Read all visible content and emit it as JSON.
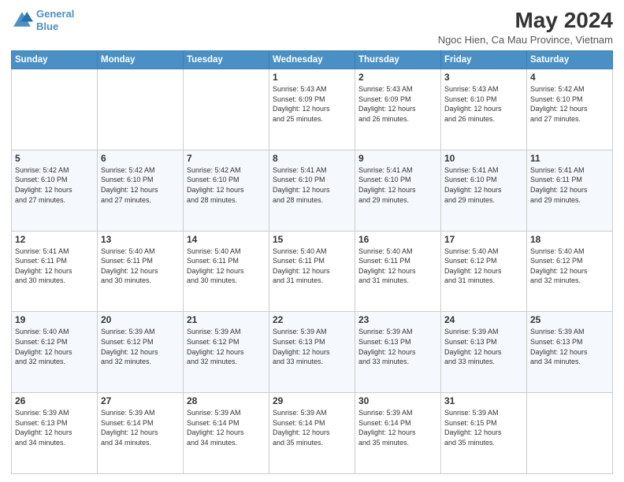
{
  "header": {
    "logo_line1": "General",
    "logo_line2": "Blue",
    "month_title": "May 2024",
    "subtitle": "Ngoc Hien, Ca Mau Province, Vietnam"
  },
  "weekdays": [
    "Sunday",
    "Monday",
    "Tuesday",
    "Wednesday",
    "Thursday",
    "Friday",
    "Saturday"
  ],
  "weeks": [
    [
      {
        "day": "",
        "info": ""
      },
      {
        "day": "",
        "info": ""
      },
      {
        "day": "",
        "info": ""
      },
      {
        "day": "1",
        "info": "Sunrise: 5:43 AM\nSunset: 6:09 PM\nDaylight: 12 hours\nand 25 minutes."
      },
      {
        "day": "2",
        "info": "Sunrise: 5:43 AM\nSunset: 6:09 PM\nDaylight: 12 hours\nand 26 minutes."
      },
      {
        "day": "3",
        "info": "Sunrise: 5:43 AM\nSunset: 6:10 PM\nDaylight: 12 hours\nand 26 minutes."
      },
      {
        "day": "4",
        "info": "Sunrise: 5:42 AM\nSunset: 6:10 PM\nDaylight: 12 hours\nand 27 minutes."
      }
    ],
    [
      {
        "day": "5",
        "info": "Sunrise: 5:42 AM\nSunset: 6:10 PM\nDaylight: 12 hours\nand 27 minutes."
      },
      {
        "day": "6",
        "info": "Sunrise: 5:42 AM\nSunset: 6:10 PM\nDaylight: 12 hours\nand 27 minutes."
      },
      {
        "day": "7",
        "info": "Sunrise: 5:42 AM\nSunset: 6:10 PM\nDaylight: 12 hours\nand 28 minutes."
      },
      {
        "day": "8",
        "info": "Sunrise: 5:41 AM\nSunset: 6:10 PM\nDaylight: 12 hours\nand 28 minutes."
      },
      {
        "day": "9",
        "info": "Sunrise: 5:41 AM\nSunset: 6:10 PM\nDaylight: 12 hours\nand 29 minutes."
      },
      {
        "day": "10",
        "info": "Sunrise: 5:41 AM\nSunset: 6:10 PM\nDaylight: 12 hours\nand 29 minutes."
      },
      {
        "day": "11",
        "info": "Sunrise: 5:41 AM\nSunset: 6:11 PM\nDaylight: 12 hours\nand 29 minutes."
      }
    ],
    [
      {
        "day": "12",
        "info": "Sunrise: 5:41 AM\nSunset: 6:11 PM\nDaylight: 12 hours\nand 30 minutes."
      },
      {
        "day": "13",
        "info": "Sunrise: 5:40 AM\nSunset: 6:11 PM\nDaylight: 12 hours\nand 30 minutes."
      },
      {
        "day": "14",
        "info": "Sunrise: 5:40 AM\nSunset: 6:11 PM\nDaylight: 12 hours\nand 30 minutes."
      },
      {
        "day": "15",
        "info": "Sunrise: 5:40 AM\nSunset: 6:11 PM\nDaylight: 12 hours\nand 31 minutes."
      },
      {
        "day": "16",
        "info": "Sunrise: 5:40 AM\nSunset: 6:11 PM\nDaylight: 12 hours\nand 31 minutes."
      },
      {
        "day": "17",
        "info": "Sunrise: 5:40 AM\nSunset: 6:12 PM\nDaylight: 12 hours\nand 31 minutes."
      },
      {
        "day": "18",
        "info": "Sunrise: 5:40 AM\nSunset: 6:12 PM\nDaylight: 12 hours\nand 32 minutes."
      }
    ],
    [
      {
        "day": "19",
        "info": "Sunrise: 5:40 AM\nSunset: 6:12 PM\nDaylight: 12 hours\nand 32 minutes."
      },
      {
        "day": "20",
        "info": "Sunrise: 5:39 AM\nSunset: 6:12 PM\nDaylight: 12 hours\nand 32 minutes."
      },
      {
        "day": "21",
        "info": "Sunrise: 5:39 AM\nSunset: 6:12 PM\nDaylight: 12 hours\nand 32 minutes."
      },
      {
        "day": "22",
        "info": "Sunrise: 5:39 AM\nSunset: 6:13 PM\nDaylight: 12 hours\nand 33 minutes."
      },
      {
        "day": "23",
        "info": "Sunrise: 5:39 AM\nSunset: 6:13 PM\nDaylight: 12 hours\nand 33 minutes."
      },
      {
        "day": "24",
        "info": "Sunrise: 5:39 AM\nSunset: 6:13 PM\nDaylight: 12 hours\nand 33 minutes."
      },
      {
        "day": "25",
        "info": "Sunrise: 5:39 AM\nSunset: 6:13 PM\nDaylight: 12 hours\nand 34 minutes."
      }
    ],
    [
      {
        "day": "26",
        "info": "Sunrise: 5:39 AM\nSunset: 6:13 PM\nDaylight: 12 hours\nand 34 minutes."
      },
      {
        "day": "27",
        "info": "Sunrise: 5:39 AM\nSunset: 6:14 PM\nDaylight: 12 hours\nand 34 minutes."
      },
      {
        "day": "28",
        "info": "Sunrise: 5:39 AM\nSunset: 6:14 PM\nDaylight: 12 hours\nand 34 minutes."
      },
      {
        "day": "29",
        "info": "Sunrise: 5:39 AM\nSunset: 6:14 PM\nDaylight: 12 hours\nand 35 minutes."
      },
      {
        "day": "30",
        "info": "Sunrise: 5:39 AM\nSunset: 6:14 PM\nDaylight: 12 hours\nand 35 minutes."
      },
      {
        "day": "31",
        "info": "Sunrise: 5:39 AM\nSunset: 6:15 PM\nDaylight: 12 hours\nand 35 minutes."
      },
      {
        "day": "",
        "info": ""
      }
    ]
  ]
}
